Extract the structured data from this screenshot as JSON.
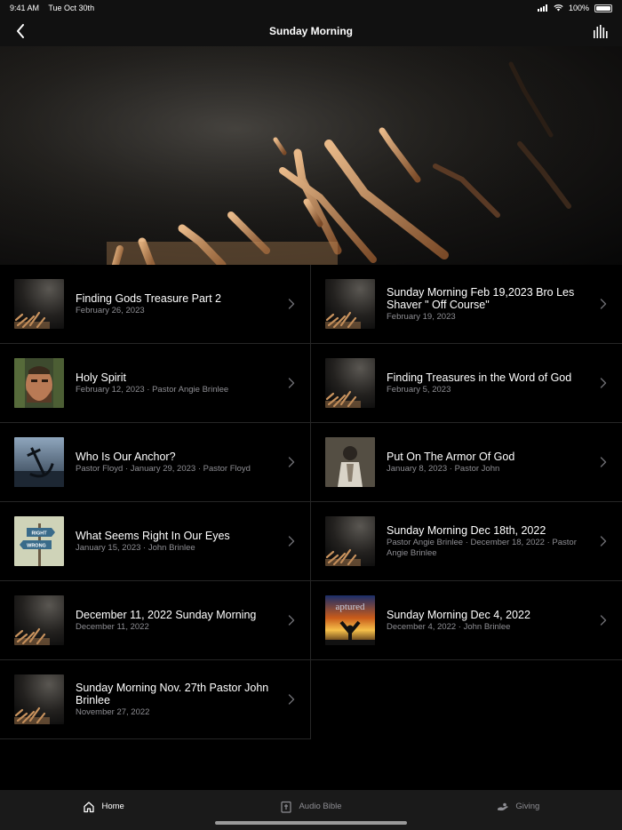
{
  "status_bar": {
    "time": "9:41 AM",
    "date": "Tue Oct 30th",
    "battery": "100%"
  },
  "nav": {
    "title": "Sunday Morning"
  },
  "sermons": [
    {
      "title": "Finding Gods Treasure Part 2",
      "subtitle": "February 26, 2023",
      "thumb": "hands"
    },
    {
      "title": "Sunday Morning Feb 19,2023 Bro Les Shaver \" Off Course\"",
      "subtitle": "February 19, 2023",
      "thumb": "hands"
    },
    {
      "title": "Holy Spirit",
      "subtitle": "February 12, 2023 · Pastor Angie Brinlee",
      "thumb": "face"
    },
    {
      "title": "Finding Treasures in the Word of God",
      "subtitle": "February 5, 2023",
      "thumb": "hands"
    },
    {
      "title": "Who Is Our Anchor?",
      "subtitle": "Pastor Floyd · January 29, 2023 · Pastor Floyd",
      "thumb": "anchor"
    },
    {
      "title": "Put On The Armor Of God",
      "subtitle": "January 8, 2023 · Pastor John",
      "thumb": "armor"
    },
    {
      "title": "What Seems Right In Our Eyes",
      "subtitle": "January 15, 2023 · John Brinlee",
      "thumb": "sign"
    },
    {
      "title": "Sunday Morning Dec 18th, 2022",
      "subtitle": "Pastor Angie Brinlee · December 18, 2022 · Pastor Angie Brinlee",
      "thumb": "hands"
    },
    {
      "title": "December 11, 2022 Sunday Morning",
      "subtitle": "December 11, 2022",
      "thumb": "hands"
    },
    {
      "title": "Sunday Morning Dec 4, 2022",
      "subtitle": "December 4, 2022 · John Brinlee",
      "thumb": "sunset"
    },
    {
      "title": "Sunday Morning Nov. 27th Pastor John Brinlee",
      "subtitle": "November 27, 2022",
      "thumb": "hands"
    }
  ],
  "thumb_text": {
    "sign_top": "RIGHT",
    "sign_bottom": "WRONG",
    "sunset_word": "aptured"
  },
  "tabs": [
    {
      "label": "Home",
      "icon": "home-icon",
      "active": true
    },
    {
      "label": "Audio Bible",
      "icon": "bible-icon",
      "active": false
    },
    {
      "label": "Giving",
      "icon": "giving-icon",
      "active": false
    }
  ]
}
